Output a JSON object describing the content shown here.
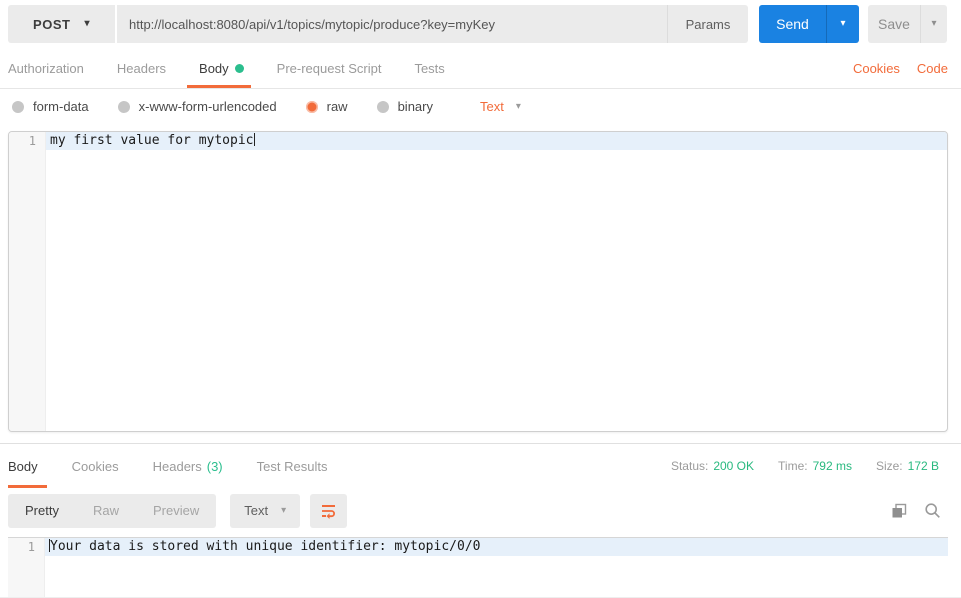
{
  "request_bar": {
    "method": "POST",
    "url": "http://localhost:8080/api/v1/topics/mytopic/produce?key=myKey",
    "params_label": "Params",
    "send_label": "Send",
    "save_label": "Save"
  },
  "request_tabs": {
    "items": [
      "Authorization",
      "Headers",
      "Body",
      "Pre-request Script",
      "Tests"
    ],
    "active": "Body",
    "cookies_link": "Cookies",
    "code_link": "Code"
  },
  "body_type": {
    "options": [
      "form-data",
      "x-www-form-urlencoded",
      "raw",
      "binary"
    ],
    "selected": "raw",
    "format_label": "Text"
  },
  "request_editor": {
    "line_number": "1",
    "line1": "my first value for mytopic"
  },
  "response": {
    "tabs": [
      "Body",
      "Cookies",
      "Headers",
      "Test Results"
    ],
    "active": "Body",
    "headers_count": "(3)",
    "status_label": "Status:",
    "status_value": "200 OK",
    "time_label": "Time:",
    "time_value": "792 ms",
    "size_label": "Size:",
    "size_value": "172 B",
    "view_modes": [
      "Pretty",
      "Raw",
      "Preview"
    ],
    "active_mode": "Pretty",
    "format_label": "Text",
    "editor": {
      "line_number": "1",
      "line1": "Your data is stored with unique identifier: mytopic/0/0"
    }
  },
  "icons": {
    "chevron_down": "▾"
  },
  "colors": {
    "accent_orange": "#f26b3a",
    "green": "#2bbe8e",
    "status_green": "#29b97f",
    "send_blue": "#1a82e2",
    "control_gray": "#ebebeb",
    "active_line": "#e6f0fa"
  }
}
